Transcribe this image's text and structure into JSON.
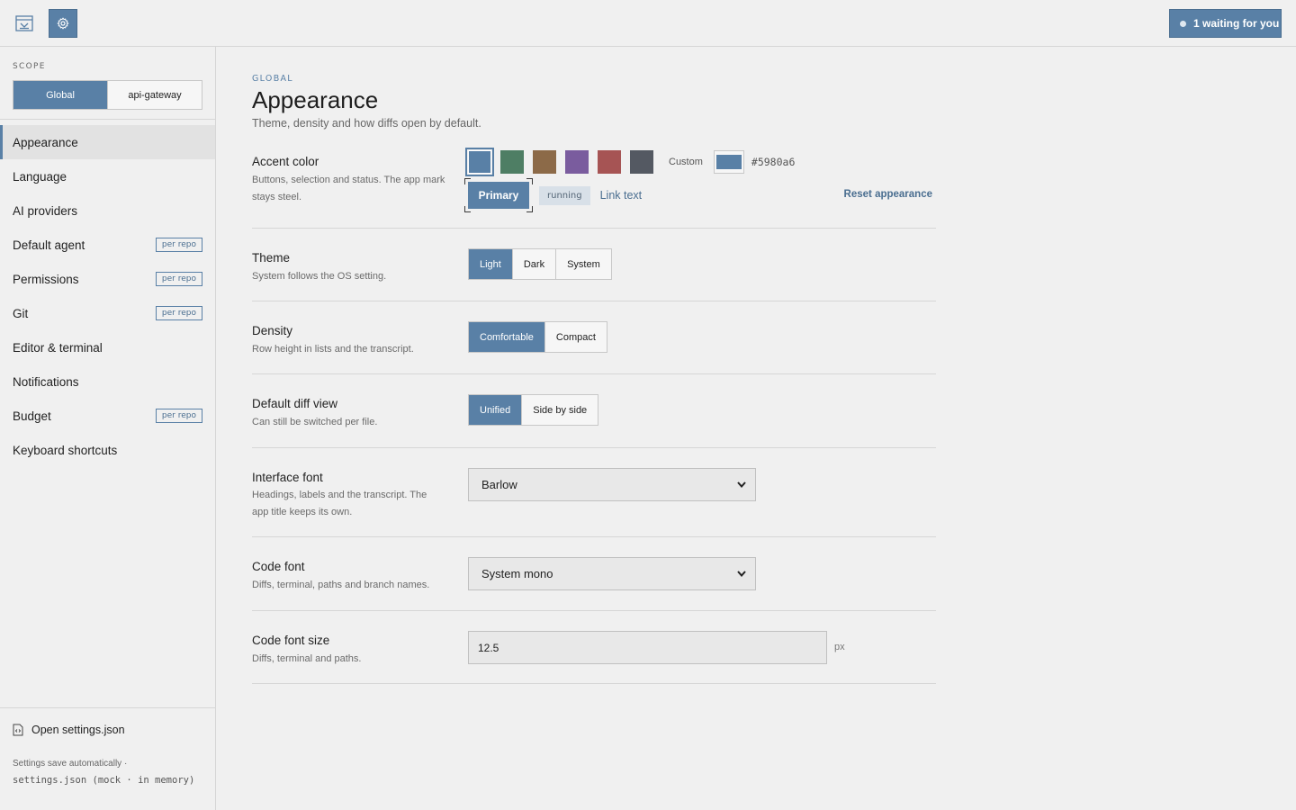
{
  "topbar": {
    "app_icon": "app-window-icon",
    "settings_icon": "gear-icon",
    "waiting_label": "1 waiting for you"
  },
  "sidebar": {
    "scope_label": "SCOPE",
    "scope_options": [
      "Global",
      "api-gateway"
    ],
    "scope_selected": "Global",
    "items": [
      {
        "label": "Appearance",
        "badge": ""
      },
      {
        "label": "Language",
        "badge": ""
      },
      {
        "label": "AI providers",
        "badge": ""
      },
      {
        "label": "Default agent",
        "badge": "per repo"
      },
      {
        "label": "Permissions",
        "badge": "per repo"
      },
      {
        "label": "Git",
        "badge": "per repo"
      },
      {
        "label": "Editor & terminal",
        "badge": ""
      },
      {
        "label": "Notifications",
        "badge": ""
      },
      {
        "label": "Budget",
        "badge": "per repo"
      },
      {
        "label": "Keyboard shortcuts",
        "badge": ""
      }
    ],
    "active_item": "Appearance",
    "open_json_label": "Open settings.json",
    "footer_prefix": "Settings save automatically ·",
    "footer_mono": "settings.json (mock · in memory)"
  },
  "main": {
    "breadcrumb": "GLOBAL",
    "title": "Appearance",
    "subtitle": "Theme, density and how diffs open by default.",
    "accent": {
      "label": "Accent color",
      "description": "Buttons, selection and status. The app mark stays steel.",
      "swatches": [
        "#5980a6",
        "#4e7e64",
        "#8c6a48",
        "#7a5c9e",
        "#a65454",
        "#545962"
      ],
      "selected": "#5980a6",
      "custom_label": "Custom",
      "custom_value": "#5980a6",
      "preview_primary": "Primary",
      "preview_tag": "running",
      "preview_link": "Link text",
      "reset_label": "Reset appearance"
    },
    "theme": {
      "label": "Theme",
      "description": "System follows the OS setting.",
      "options": [
        "Light",
        "Dark",
        "System"
      ],
      "selected": "Light"
    },
    "density": {
      "label": "Density",
      "description": "Row height in lists and the transcript.",
      "options": [
        "Comfortable",
        "Compact"
      ],
      "selected": "Comfortable"
    },
    "diff_view": {
      "label": "Default diff view",
      "description": "Can still be switched per file.",
      "options": [
        "Unified",
        "Side by side"
      ],
      "selected": "Unified"
    },
    "interface_font": {
      "label": "Interface font",
      "description": "Headings, labels and the transcript. The app title keeps its own.",
      "value": "Barlow"
    },
    "code_font": {
      "label": "Code font",
      "description": "Diffs, terminal, paths and branch names.",
      "value": "System mono"
    },
    "code_font_size": {
      "label": "Code font size",
      "description": "Diffs, terminal and paths.",
      "value": "12.5",
      "unit": "px"
    }
  },
  "colors": {
    "accent": "#5980a6",
    "background": "#f0f0f0",
    "border": "#d6d6d6"
  }
}
